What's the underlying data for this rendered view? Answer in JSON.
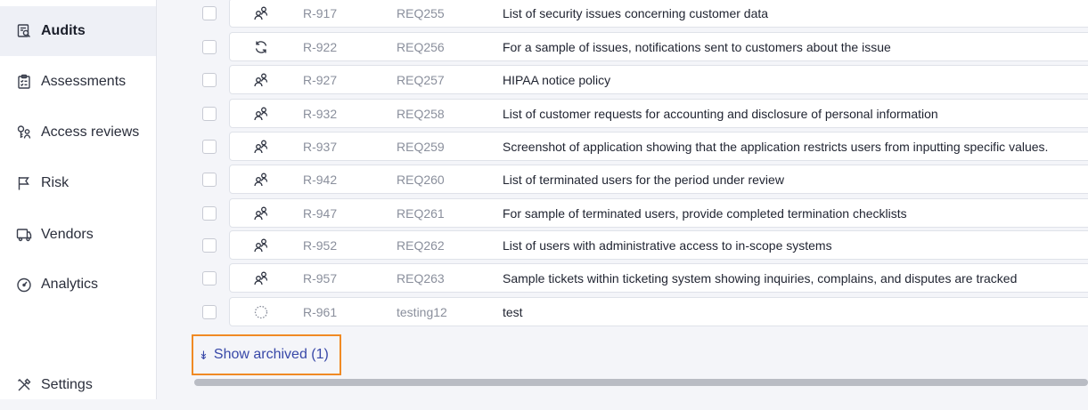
{
  "sidebar": {
    "items": [
      {
        "label": "Audits",
        "icon": "audit-search-icon",
        "active": true
      },
      {
        "label": "Assessments",
        "icon": "clipboard-checklist-icon",
        "active": false
      },
      {
        "label": "Access reviews",
        "icon": "key-person-icon",
        "active": false
      },
      {
        "label": "Risk",
        "icon": "flag-icon",
        "active": false
      },
      {
        "label": "Vendors",
        "icon": "truck-icon",
        "active": false
      },
      {
        "label": "Analytics",
        "icon": "gauge-icon",
        "active": false
      },
      {
        "label": "Settings",
        "icon": "tools-icon",
        "active": false
      }
    ]
  },
  "rows": [
    {
      "id": "R-917",
      "req": "REQ255",
      "title": "List of security issues concerning customer data",
      "status_icon": "users-icon"
    },
    {
      "id": "R-922",
      "req": "REQ256",
      "title": "For a sample of issues, notifications sent to customers about the issue",
      "status_icon": "refresh-icon"
    },
    {
      "id": "R-927",
      "req": "REQ257",
      "title": "HIPAA notice policy",
      "status_icon": "users-icon"
    },
    {
      "id": "R-932",
      "req": "REQ258",
      "title": "List of customer requests for accounting and disclosure of personal information",
      "status_icon": "users-icon"
    },
    {
      "id": "R-937",
      "req": "REQ259",
      "title": "Screenshot of application showing that the application restricts users from inputting specific values.",
      "status_icon": "users-icon"
    },
    {
      "id": "R-942",
      "req": "REQ260",
      "title": "List of terminated users for the period under review",
      "status_icon": "users-icon"
    },
    {
      "id": "R-947",
      "req": "REQ261",
      "title": "For sample of terminated users, provide completed termination checklists",
      "status_icon": "users-icon"
    },
    {
      "id": "R-952",
      "req": "REQ262",
      "title": "List of users with administrative access to in-scope systems",
      "status_icon": "users-icon"
    },
    {
      "id": "R-957",
      "req": "REQ263",
      "title": "Sample tickets within ticketing system showing inquiries, complains, and disputes are tracked",
      "status_icon": "users-icon"
    },
    {
      "id": "R-961",
      "req": "testing12",
      "title": "test",
      "status_icon": "dashed-circle-icon"
    }
  ],
  "footer": {
    "show_archived_label": "Show archived (1)",
    "chevron_icon": "double-chevron-down-icon"
  },
  "colors": {
    "accent": "#3848a8",
    "highlight": "#f08a24"
  }
}
